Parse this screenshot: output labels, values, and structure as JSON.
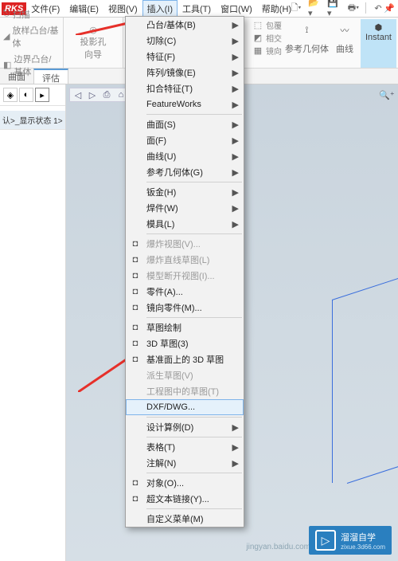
{
  "logo": "RKS",
  "menubar": [
    "文件(F)",
    "编辑(E)",
    "视图(V)",
    "插入(I)",
    "工具(T)",
    "窗口(W)",
    "帮助(H)"
  ],
  "active_menu_index": 3,
  "doc_icons": [
    "file-new-icon",
    "file-open-icon",
    "save-icon",
    "print-icon",
    "undo-icon"
  ],
  "tool_left": [
    {
      "icon": "scan-icon",
      "label": "扫描"
    },
    {
      "icon": "boss-icon",
      "label": "放样凸台/基体"
    },
    {
      "icon": "boundary-icon",
      "label": "边界凸台/基体"
    }
  ],
  "tool_mid": {
    "label1": "投影孔",
    "label2": "向导"
  },
  "rt_icons": [
    "rib-icon",
    "draft-icon",
    "shell-icon",
    "hole-icon",
    "mirror-icon",
    "pattern-icon"
  ],
  "rt_big": [
    {
      "icon": "refgeom-icon",
      "label": "参考几何体"
    },
    {
      "icon": "curve-icon",
      "label": "曲线"
    }
  ],
  "rt_labels_small": [
    "包覆",
    "相交",
    "镜向"
  ],
  "instant": "Instant",
  "tabs": [
    "曲面",
    "评估"
  ],
  "side_state": "认>_显示状态 1>",
  "dropdown": [
    {
      "t": "凸台/基体(B)",
      "a": true
    },
    {
      "t": "切除(C)",
      "a": true
    },
    {
      "t": "特征(F)",
      "a": true
    },
    {
      "t": "阵列/镜像(E)",
      "a": true
    },
    {
      "t": "扣合特征(T)",
      "a": true
    },
    {
      "t": "FeatureWorks",
      "a": true
    },
    {
      "sep": true
    },
    {
      "t": "曲面(S)",
      "a": true
    },
    {
      "t": "面(F)",
      "a": true
    },
    {
      "t": "曲线(U)",
      "a": true
    },
    {
      "t": "参考几何体(G)",
      "a": true
    },
    {
      "sep": true
    },
    {
      "t": "钣金(H)",
      "a": true
    },
    {
      "t": "焊件(W)",
      "a": true
    },
    {
      "t": "模具(L)",
      "a": true
    },
    {
      "sep": true
    },
    {
      "t": "爆炸视图(V)...",
      "d": true,
      "i": "explode-icon"
    },
    {
      "t": "爆炸直线草图(L)",
      "d": true,
      "i": "explode-line-icon"
    },
    {
      "t": "模型断开视图(I)...",
      "d": true,
      "i": "break-icon"
    },
    {
      "t": "零件(A)...",
      "i": "part-icon"
    },
    {
      "t": "镜向零件(M)...",
      "i": "mirror-part-icon"
    },
    {
      "sep": true
    },
    {
      "t": "草图绘制",
      "i": "sketch-icon"
    },
    {
      "t": "3D 草图(3)",
      "i": "sketch3d-icon"
    },
    {
      "t": "基准面上的 3D 草图",
      "i": "sketch3d-plane-icon"
    },
    {
      "t": "派生草图(V)",
      "d": true
    },
    {
      "t": "工程图中的草图(T)",
      "d": true
    },
    {
      "t": "DXF/DWG...",
      "hl": true
    },
    {
      "sep": true
    },
    {
      "t": "设计算例(D)",
      "a": true
    },
    {
      "sep": true
    },
    {
      "t": "表格(T)",
      "a": true
    },
    {
      "t": "注解(N)",
      "a": true
    },
    {
      "sep": true
    },
    {
      "t": "对象(O)...",
      "i": "object-icon"
    },
    {
      "t": "超文本链接(Y)...",
      "i": "hyperlink-icon"
    },
    {
      "sep": true
    },
    {
      "t": "自定义菜单(M)"
    }
  ],
  "watermark": {
    "title": "溜溜自学",
    "sub": "zixue.3d66.com"
  },
  "wm_url": "jingyan.baidu.com"
}
